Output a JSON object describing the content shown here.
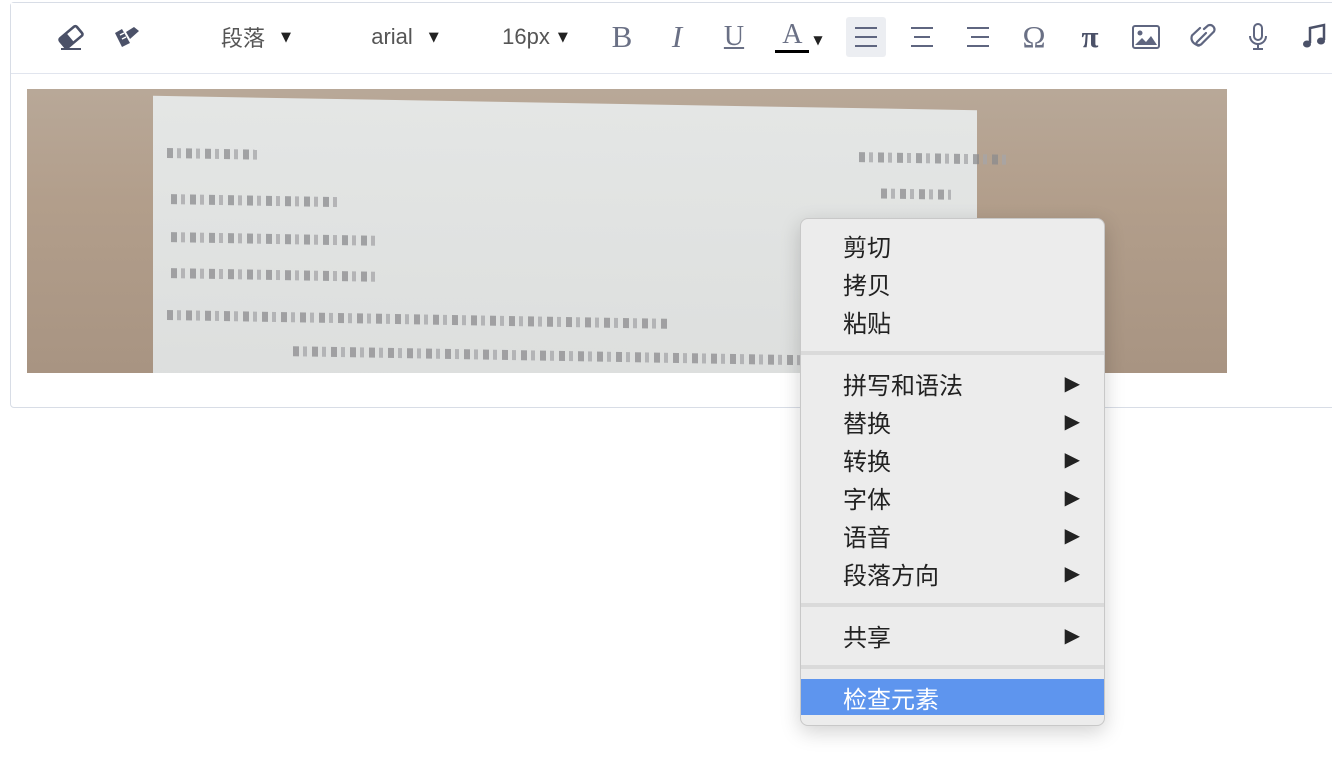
{
  "toolbar": {
    "paragraph_label": "段落",
    "font_label": "arial",
    "size_label": "16px",
    "bold": "B",
    "italic": "I",
    "underline": "U",
    "color_letter": "A",
    "omega": "Ω",
    "pi": "π",
    "icons": [
      "eraser-icon",
      "format-brush-icon",
      "align-left-icon",
      "align-center-icon",
      "align-right-icon",
      "image-icon",
      "link-icon",
      "microphone-icon",
      "music-note-icon"
    ]
  },
  "context_menu": {
    "group1": [
      "剪切",
      "拷贝",
      "粘贴"
    ],
    "group2": [
      "拼写和语法",
      "替换",
      "转换",
      "字体",
      "语音",
      "段落方向"
    ],
    "group3": [
      "共享"
    ],
    "group4": [
      "检查元素"
    ],
    "submenu_arrow": "▶",
    "highlight_color": "#5e95ee"
  }
}
